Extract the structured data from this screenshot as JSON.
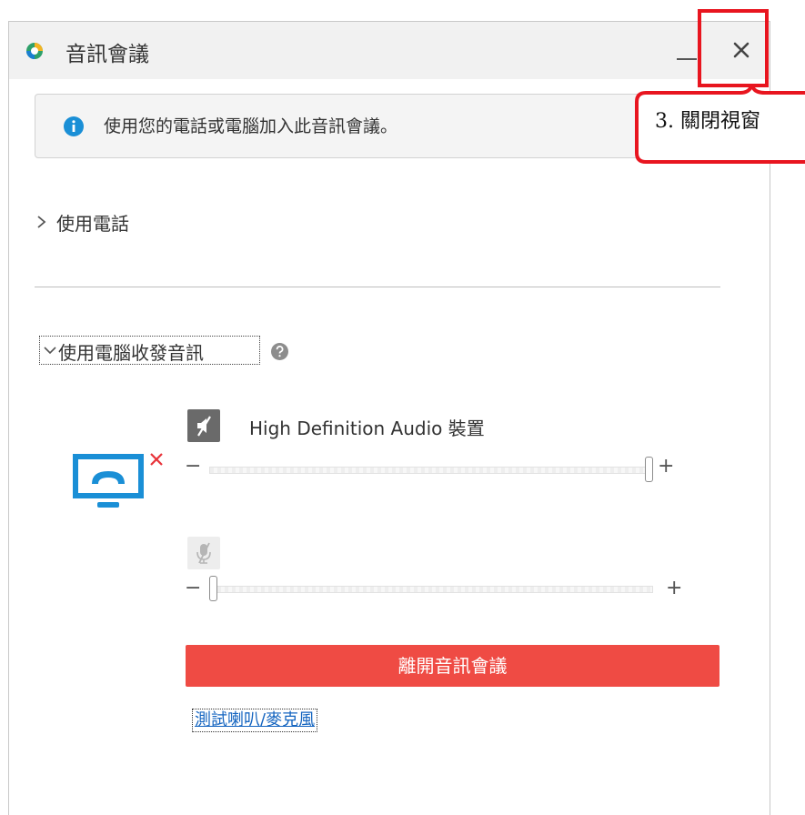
{
  "window": {
    "title": "音訊會議",
    "minimize_label": "_",
    "close_label": "×"
  },
  "info": {
    "message": "使用您的電話或電腦加入此音訊會議。"
  },
  "phone_section": {
    "label": "使用電話",
    "expanded": false
  },
  "computer_section": {
    "label": "使用電腦收發音訊",
    "expanded": true
  },
  "speaker": {
    "device_name": "High Definition Audio 裝置",
    "muted": true,
    "volume_fraction": 1.0,
    "minus_label": "−",
    "plus_label": "+"
  },
  "microphone": {
    "muted": true,
    "volume_fraction": 0.0,
    "minus_label": "−",
    "plus_label": "+"
  },
  "actions": {
    "leave_label": "離開音訊會議",
    "test_label": "測試喇叭/麥克風"
  },
  "annotation": {
    "text": "3. 關閉視窗"
  },
  "colors": {
    "accent_blue": "#1a8fd6",
    "danger_red": "#ef4b44",
    "annotation_red": "#e8151f",
    "link_blue": "#1565c0"
  },
  "icons": {
    "app_logo": "webex-logo-icon",
    "info": "info-icon",
    "help": "help-icon",
    "monitor": "monitor-phone-disconnected-icon",
    "speaker": "speaker-muted-icon",
    "microphone": "microphone-muted-icon"
  }
}
